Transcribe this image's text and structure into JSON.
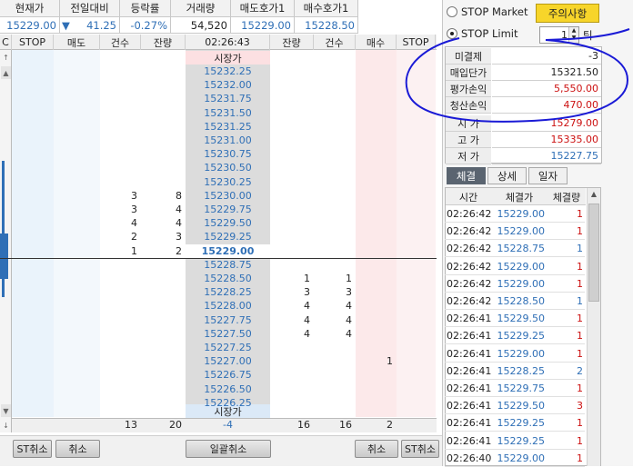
{
  "quote": {
    "headers": [
      "현재가",
      "전일대비",
      "등락률",
      "거래량",
      "매도호가1",
      "매수호가1"
    ],
    "current_price": "15229.00",
    "change_arrow": "▼",
    "change": "41.25",
    "change_rate": "-0.27%",
    "volume": "54,520",
    "ask1": "15229.00",
    "bid1": "15228.50"
  },
  "orderbook": {
    "headers": [
      "STOP",
      "매도",
      "건수",
      "잔량",
      "02:26:43",
      "잔량",
      "건수",
      "매수",
      "STOP"
    ],
    "left_marker": "C",
    "market_top": "시장가",
    "market_bottom": "시장가",
    "prices": [
      "15232.25",
      "15232.00",
      "15231.75",
      "15231.50",
      "15231.25",
      "15231.00",
      "15230.75",
      "15230.50",
      "15230.25",
      "15230.00",
      "15229.75",
      "15229.50",
      "15229.25",
      "15229.00",
      "15228.75",
      "15228.50",
      "15228.25",
      "15228.00",
      "15227.75",
      "15227.50",
      "15227.25",
      "15227.00",
      "15226.75",
      "15226.50",
      "15226.25"
    ],
    "ask_count": [
      "",
      "",
      "",
      "",
      "",
      "",
      "",
      "",
      "",
      "3",
      "3",
      "4",
      "2",
      "1",
      "",
      "",
      "",
      "",
      "",
      "",
      "",
      "",
      "",
      "",
      ""
    ],
    "ask_qty": [
      "",
      "",
      "",
      "",
      "",
      "",
      "",
      "",
      "",
      "8",
      "4",
      "4",
      "3",
      "2",
      "",
      "",
      "",
      "",
      "",
      "",
      "",
      "",
      "",
      "",
      ""
    ],
    "bid_qty": [
      "",
      "",
      "",
      "",
      "",
      "",
      "",
      "",
      "",
      "",
      "",
      "",
      "",
      "",
      "",
      "1",
      "3",
      "4",
      "4",
      "4",
      "",
      "",
      "",
      "",
      ""
    ],
    "bid_count": [
      "",
      "",
      "",
      "",
      "",
      "",
      "",
      "",
      "",
      "",
      "",
      "",
      "",
      "",
      "",
      "1",
      "3",
      "4",
      "4",
      "4",
      "",
      "",
      "",
      "",
      ""
    ],
    "buy_orders": [
      "",
      "",
      "",
      "",
      "",
      "",
      "",
      "",
      "",
      "",
      "",
      "",
      "",
      "",
      "",
      "",
      "",
      "",
      "",
      "",
      "",
      "1",
      "",
      "",
      ""
    ],
    "totals": {
      "ask_count": "13",
      "ask_qty": "20",
      "net": "-4",
      "bid_qty": "16",
      "bid_count": "16",
      "buy": "2"
    }
  },
  "buttons": {
    "st_cancel_left": "ST취소",
    "cancel_left": "취소",
    "cancel_all": "일괄취소",
    "cancel_right": "취소",
    "st_cancel_right": "ST취소"
  },
  "stop": {
    "market_label": "STOP Market",
    "limit_label": "STOP Limit",
    "caution_button": "주의사항",
    "tick_value": "1",
    "tick_unit": "틱"
  },
  "position": {
    "labels": [
      "미결제",
      "매입단가",
      "평가손익",
      "청산손익",
      "시 가",
      "고 가",
      "저 가"
    ],
    "values": [
      "-3",
      "15321.50",
      "5,550.00",
      "470.00",
      "15279.00",
      "15335.00",
      "15227.75"
    ],
    "colors": [
      "#222222",
      "#222222",
      "#cc1111",
      "#cc1111",
      "#cc1111",
      "#cc1111",
      "#2f6fb6"
    ]
  },
  "trade_tabs": [
    "체결",
    "상세",
    "일자"
  ],
  "trades": {
    "headers": [
      "시간",
      "체결가",
      "체결량"
    ],
    "rows": [
      {
        "time": "02:26:42",
        "price": "15229.00",
        "qty": "1",
        "side": "buy"
      },
      {
        "time": "02:26:42",
        "price": "15229.00",
        "qty": "1",
        "side": "buy"
      },
      {
        "time": "02:26:42",
        "price": "15228.75",
        "qty": "1",
        "side": "sell"
      },
      {
        "time": "02:26:42",
        "price": "15229.00",
        "qty": "1",
        "side": "buy"
      },
      {
        "time": "02:26:42",
        "price": "15229.00",
        "qty": "1",
        "side": "buy"
      },
      {
        "time": "02:26:42",
        "price": "15228.50",
        "qty": "1",
        "side": "sell"
      },
      {
        "time": "02:26:41",
        "price": "15229.50",
        "qty": "1",
        "side": "buy"
      },
      {
        "time": "02:26:41",
        "price": "15229.25",
        "qty": "1",
        "side": "buy"
      },
      {
        "time": "02:26:41",
        "price": "15229.00",
        "qty": "1",
        "side": "buy"
      },
      {
        "time": "02:26:41",
        "price": "15228.25",
        "qty": "2",
        "side": "sell"
      },
      {
        "time": "02:26:41",
        "price": "15229.75",
        "qty": "1",
        "side": "buy"
      },
      {
        "time": "02:26:41",
        "price": "15229.50",
        "qty": "3",
        "side": "buy"
      },
      {
        "time": "02:26:41",
        "price": "15229.25",
        "qty": "1",
        "side": "buy"
      },
      {
        "time": "02:26:41",
        "price": "15229.25",
        "qty": "1",
        "side": "buy"
      },
      {
        "time": "02:26:40",
        "price": "15229.00",
        "qty": "1",
        "side": "buy"
      }
    ]
  },
  "colors": {
    "up": "#cc1111",
    "down": "#2f6fb6",
    "annotation": "#1a1ad6",
    "caution_bg": "#f7d52a"
  }
}
